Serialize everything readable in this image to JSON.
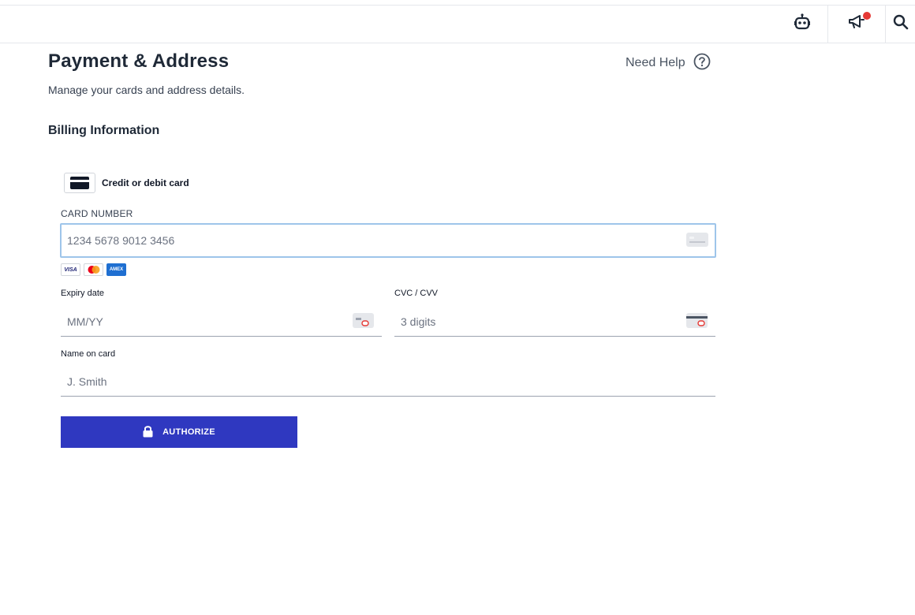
{
  "topbar": {
    "icons": [
      "robot-icon",
      "megaphone-icon",
      "search-icon"
    ],
    "notification_dot_color": "#e53935"
  },
  "header": {
    "title": "Payment & Address",
    "subtitle": "Manage your cards and address details.",
    "help_label": "Need Help",
    "help_icon": "question-circle-icon"
  },
  "billing": {
    "section_title": "Billing Information",
    "method_label": "Credit or debit card",
    "method_icon": "credit-card-icon",
    "card_number": {
      "label": "CARD NUMBER",
      "placeholder": "1234 5678 9012 3456",
      "value": ""
    },
    "brands": [
      "VISA",
      "Mastercard",
      "AMEX"
    ],
    "expiry": {
      "label": "Expiry date",
      "placeholder": "MM/YY",
      "value": ""
    },
    "cvc": {
      "label": "CVC / CVV",
      "placeholder": "3 digits",
      "value": ""
    },
    "name": {
      "label": "Name on card",
      "placeholder": "J. Smith",
      "value": ""
    },
    "authorize_label": "AUTHORIZE",
    "authorize_icon": "lock-icon"
  },
  "colors": {
    "primary": "#2f38c0",
    "focus_border": "#9ec5ea",
    "text": "#1f2937"
  }
}
